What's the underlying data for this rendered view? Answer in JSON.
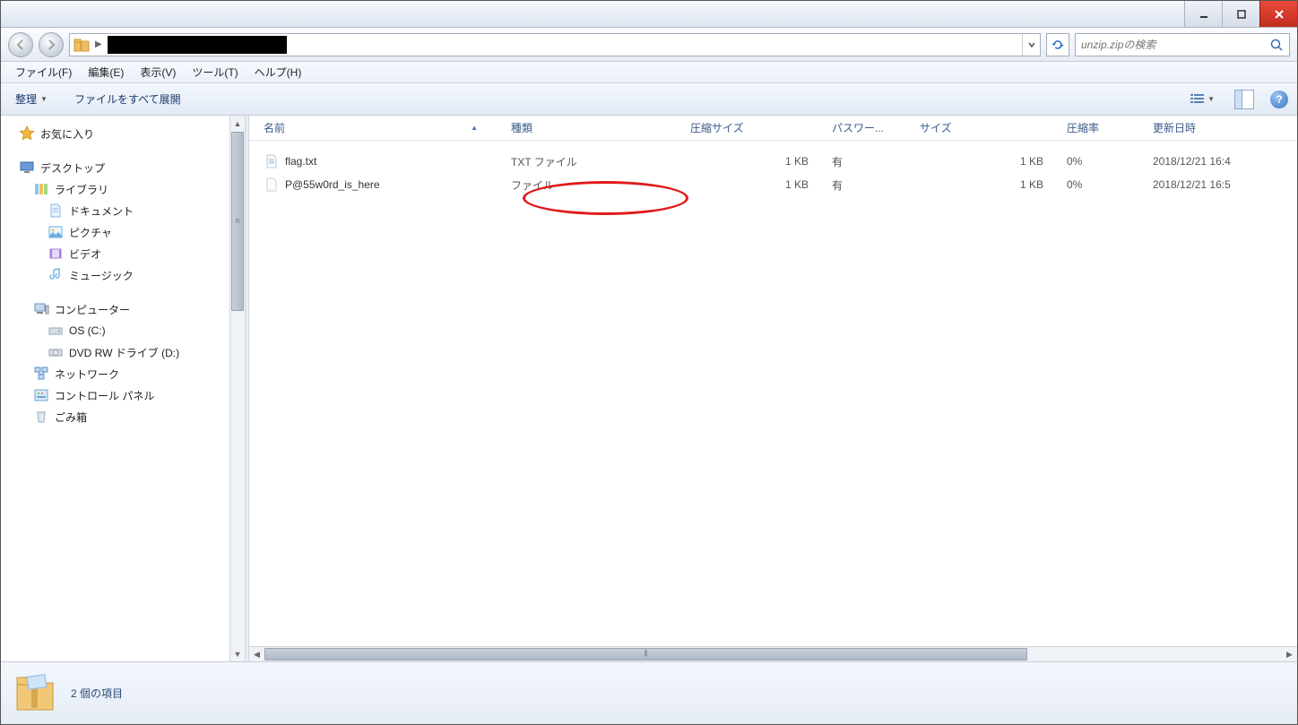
{
  "window": {
    "minimize": "_",
    "maximize": "□",
    "close": "×"
  },
  "nav": {
    "path_redacted": "",
    "search_placeholder": "unzip.zipの検索"
  },
  "menu": {
    "file": "ファイル(F)",
    "edit": "編集(E)",
    "view": "表示(V)",
    "tools": "ツール(T)",
    "help": "ヘルプ(H)"
  },
  "toolbar": {
    "organize": "整理",
    "extract_all": "ファイルをすべて展開"
  },
  "sidebar": {
    "favorites": "お気に入り",
    "desktop": "デスクトップ",
    "libraries": "ライブラリ",
    "documents": "ドキュメント",
    "pictures": "ピクチャ",
    "videos": "ビデオ",
    "music": "ミュージック",
    "computer": "コンピューター",
    "os_c": "OS (C:)",
    "dvd_d": "DVD RW ドライブ (D:)",
    "network": "ネットワーク",
    "control_panel": "コントロール パネル",
    "recycle_bin": "ごみ箱"
  },
  "columns": {
    "name": "名前",
    "type": "種類",
    "compressed_size": "圧縮サイズ",
    "password": "パスワー...",
    "size": "サイズ",
    "ratio": "圧縮率",
    "modified": "更新日時"
  },
  "files": [
    {
      "name": "flag.txt",
      "type": "TXT ファイル",
      "csize": "1 KB",
      "pw": "有",
      "size": "1 KB",
      "ratio": "0%",
      "date": "2018/12/21 16:4"
    },
    {
      "name": "P@55w0rd_is_here",
      "type": "ファイル",
      "csize": "1 KB",
      "pw": "有",
      "size": "1 KB",
      "ratio": "0%",
      "date": "2018/12/21 16:5"
    }
  ],
  "status": {
    "text": "2 個の項目"
  }
}
